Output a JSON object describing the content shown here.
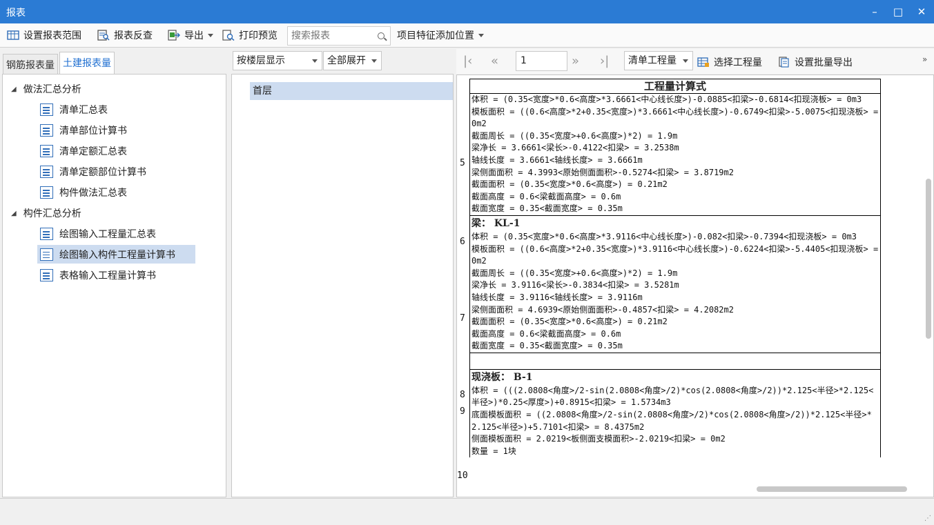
{
  "window": {
    "title": "报表",
    "controls": {
      "minimize": "–",
      "maximize": "□",
      "close": "✕"
    }
  },
  "toolbar": {
    "set_range": "设置报表范围",
    "reverse_check": "报表反查",
    "export": "导出",
    "print_preview": "打印预览",
    "search_placeholder": "搜索报表",
    "feature_position": "项目特征添加位置"
  },
  "left_tabs": [
    "钢筋报表量",
    "土建报表量"
  ],
  "tree": {
    "group1": "做法汇总分析",
    "group1_items": [
      "清单汇总表",
      "清单部位计算书",
      "清单定额汇总表",
      "清单定额部位计算书",
      "构件做法汇总表"
    ],
    "group2": "构件汇总分析",
    "group2_items": [
      "绘图输入工程量汇总表",
      "绘图输入构件工程量计算书",
      "表格输入工程量计算书"
    ],
    "selected": "绘图输入构件工程量计算书"
  },
  "middle": {
    "display_mode": "按楼层显示",
    "expand_mode": "全部展开",
    "floors": [
      "首层"
    ]
  },
  "report_toolbar": {
    "page": "1",
    "quantity_type": "清单工程量",
    "select_quantity": "选择工程量",
    "batch_export": "设置批量导出",
    "more": "»"
  },
  "report": {
    "column_header": "工程量计算式",
    "row5": {
      "num": "5",
      "lines": [
        "体积 = (0.35<宽度>*0.6<高度>*3.6661<中心线长度>)-0.0885<扣梁>-0.6814<扣现浇板> = 0m3",
        "模板面积 = ((0.6<高度>*2+0.35<宽度>)*3.6661<中心线长度>)-0.6749<扣梁>-5.0075<扣现浇板> = 0m2",
        "截面周长 = ((0.35<宽度>+0.6<高度>)*2) = 1.9m",
        "梁净长 = 3.6661<梁长>-0.4122<扣梁> = 3.2538m",
        "轴线长度 = 3.6661<轴线长度> = 3.6661m",
        "梁侧面面积 = 4.3993<原始侧面面积>-0.5274<扣梁> = 3.8719m2",
        "截面面积 = (0.35<宽度>*0.6<高度>) = 0.21m2",
        "截面高度 = 0.6<梁截面高度> = 0.6m",
        "截面宽度 = 0.35<截面宽度> = 0.35m"
      ]
    },
    "row6": {
      "num": "6",
      "heading": "梁： KL-1"
    },
    "row7": {
      "num": "7",
      "lines": [
        "体积 = (0.35<宽度>*0.6<高度>*3.9116<中心线长度>)-0.082<扣梁>-0.7394<扣现浇板> = 0m3",
        "模板面积 = ((0.6<高度>*2+0.35<宽度>)*3.9116<中心线长度>)-0.6224<扣梁>-5.4405<扣现浇板> = 0m2",
        "截面周长 = ((0.35<宽度>+0.6<高度>)*2) = 1.9m",
        "梁净长 = 3.9116<梁长>-0.3834<扣梁> = 3.5281m",
        "轴线长度 = 3.9116<轴线长度> = 3.9116m",
        "梁侧面面积 = 4.6939<原始侧面面积>-0.4857<扣梁> = 4.2082m2",
        "截面面积 = (0.35<宽度>*0.6<高度>) = 0.21m2",
        "截面高度 = 0.6<梁截面高度> = 0.6m",
        "截面宽度 = 0.35<截面宽度> = 0.35m"
      ]
    },
    "row8": {
      "num": "8"
    },
    "row9": {
      "num": "9",
      "heading": "现浇板： B-1"
    },
    "row10": {
      "num": "10",
      "lines": [
        "体积 = (((2.0808<角度>/2-sin(2.0808<角度>/2)*cos(2.0808<角度>/2))*2.125<半径>*2.125<半径>)*0.25<厚度>)+0.8915<扣梁> = 1.5734m3",
        "底面模板面积 = ((2.0808<角度>/2-sin(2.0808<角度>/2)*cos(2.0808<角度>/2))*2.125<半径>*2.125<半径>)+5.7101<扣梁> = 8.4375m2",
        "侧面模板面积 = 2.0219<板侧面支模面积>-2.0219<扣梁> = 0m2",
        "数量 = 1块"
      ]
    }
  },
  "colors": {
    "titlebar": "#2b7bd4",
    "selection": "#cddcf0",
    "accent": "#1f6fd1"
  }
}
